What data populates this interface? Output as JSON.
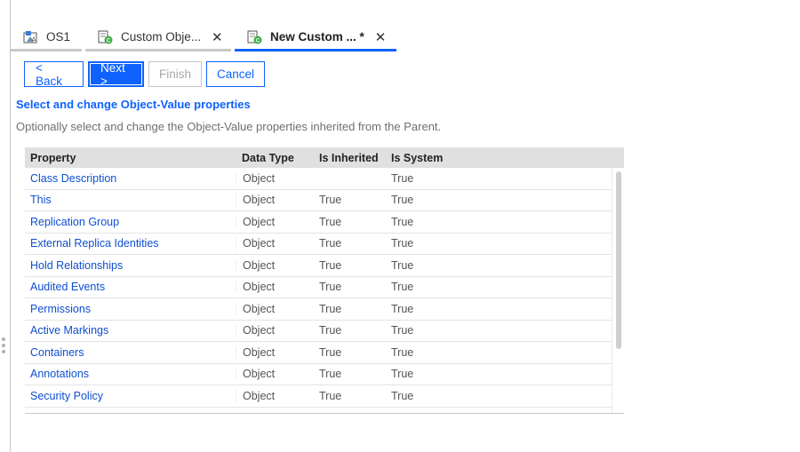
{
  "tabs": [
    {
      "label": "OS1",
      "icon": "object-store-icon",
      "closable": false,
      "active": false
    },
    {
      "label": "Custom Obje...",
      "icon": "class-definition-icon",
      "closable": true,
      "active": false
    },
    {
      "label": "New Custom ... *",
      "icon": "class-definition-icon",
      "closable": true,
      "active": true
    }
  ],
  "toolbar": {
    "back_label": "< Back",
    "next_label": "Next >",
    "finish_label": "Finish",
    "cancel_label": "Cancel"
  },
  "page": {
    "heading": "Select and change Object-Value properties",
    "description": "Optionally select and change the Object-Value properties inherited from the Parent."
  },
  "table": {
    "columns": [
      "Property",
      "Data Type",
      "Is Inherited",
      "Is System"
    ],
    "rows": [
      [
        "Class Description",
        "Object",
        "",
        "True"
      ],
      [
        "This",
        "Object",
        "True",
        "True"
      ],
      [
        "Replication Group",
        "Object",
        "True",
        "True"
      ],
      [
        "External Replica Identities",
        "Object",
        "True",
        "True"
      ],
      [
        "Hold Relationships",
        "Object",
        "True",
        "True"
      ],
      [
        "Audited Events",
        "Object",
        "True",
        "True"
      ],
      [
        "Permissions",
        "Object",
        "True",
        "True"
      ],
      [
        "Active Markings",
        "Object",
        "True",
        "True"
      ],
      [
        "Containers",
        "Object",
        "True",
        "True"
      ],
      [
        "Annotations",
        "Object",
        "True",
        "True"
      ],
      [
        "Security Policy",
        "Object",
        "True",
        "True"
      ]
    ]
  },
  "colors": {
    "accent": "#0f62fe",
    "link": "#0f4fd1",
    "header_bg": "#e0e0e0"
  }
}
